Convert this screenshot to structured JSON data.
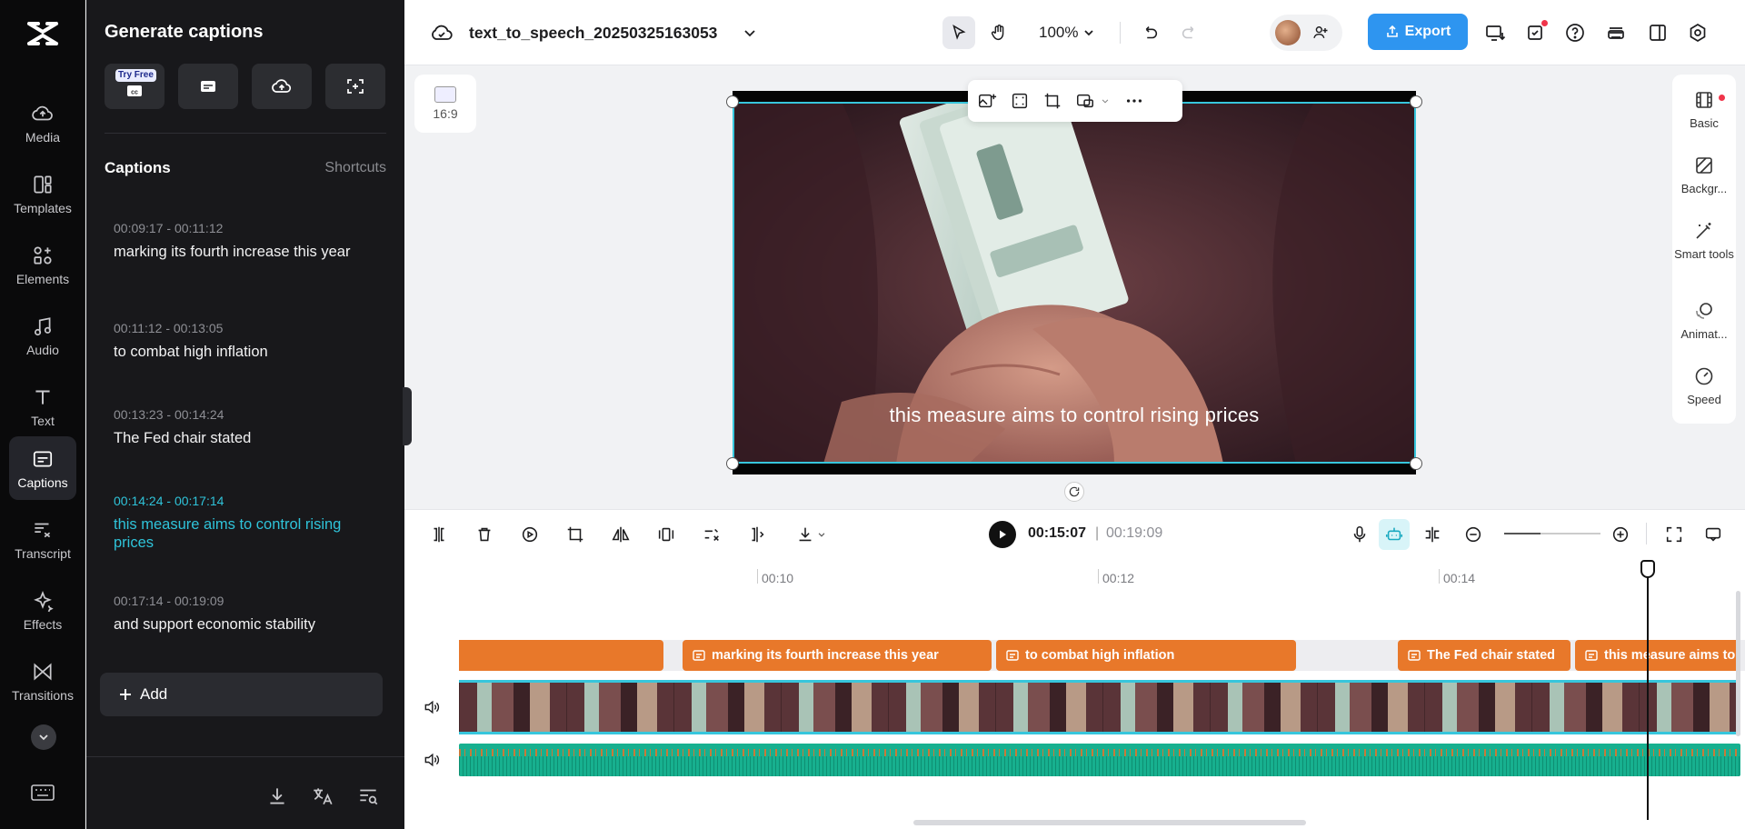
{
  "nav": {
    "items": [
      {
        "label": "Media",
        "icon": "cloud-upload-icon"
      },
      {
        "label": "Templates",
        "icon": "templates-icon"
      },
      {
        "label": "Elements",
        "icon": "elements-icon"
      },
      {
        "label": "Audio",
        "icon": "music-note-icon"
      },
      {
        "label": "Text",
        "icon": "text-t-icon"
      },
      {
        "label": "Captions",
        "icon": "captions-icon"
      },
      {
        "label": "Transcript",
        "icon": "transcript-icon"
      },
      {
        "label": "Effects",
        "icon": "sparkle-icon"
      },
      {
        "label": "Transitions",
        "icon": "transitions-icon"
      }
    ]
  },
  "panel": {
    "title": "Generate captions",
    "try_free": "Try Free",
    "section_title": "Captions",
    "shortcuts": "Shortcuts",
    "captions": [
      {
        "time": "00:09:17 - 00:11:12",
        "text": "marking its fourth increase this year"
      },
      {
        "time": "00:11:12 - 00:13:05",
        "text": "to combat high inflation"
      },
      {
        "time": "00:13:23 - 00:14:24",
        "text": "The Fed chair stated"
      },
      {
        "time": "00:14:24 - 00:17:14",
        "text": "this measure aims to control rising prices"
      },
      {
        "time": "00:17:14 - 00:19:09",
        "text": "and support economic stability"
      }
    ],
    "add_label": "Add"
  },
  "topbar": {
    "project_name": "text_to_speech_20250325163053",
    "zoom": "100%",
    "export_label": "Export"
  },
  "canvas": {
    "ratio": "16:9",
    "subtitle": "this measure aims to control rising prices"
  },
  "right_panel": {
    "items": [
      "Basic",
      "Backgr...",
      "Smart tools",
      "Animat...",
      "Speed"
    ]
  },
  "timeline": {
    "current_time": "00:15:07",
    "separator": "|",
    "total_time": "00:19:09",
    "ticks": [
      "00:10",
      "00:12",
      "00:14"
    ],
    "clips": [
      {
        "text": ""
      },
      {
        "text": "marking its fourth increase this year"
      },
      {
        "text": "to combat high inflation"
      },
      {
        "text": "The Fed chair stated"
      },
      {
        "text": "this measure aims to control rising prices"
      }
    ]
  },
  "colors": {
    "accent": "#37c6dc",
    "export": "#2e95f0",
    "caption_clip": "#e8782a",
    "audio_track": "#17b08f"
  }
}
